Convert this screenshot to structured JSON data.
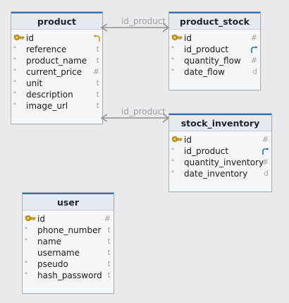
{
  "tables": {
    "product": {
      "name": "product",
      "fields": [
        {
          "name": "id",
          "type": "",
          "pk": true,
          "required": true,
          "ref": "in"
        },
        {
          "name": "reference",
          "type": "t",
          "required": true
        },
        {
          "name": "product_name",
          "type": "t",
          "required": true
        },
        {
          "name": "current_price",
          "type": "#",
          "required": true
        },
        {
          "name": "unit",
          "type": "t",
          "required": true
        },
        {
          "name": "description",
          "type": "t",
          "required": true
        },
        {
          "name": "image_url",
          "type": "t",
          "required": true
        }
      ]
    },
    "product_stock": {
      "name": "product_stock",
      "fields": [
        {
          "name": "id",
          "type": "#",
          "pk": true,
          "required": true
        },
        {
          "name": "id_product",
          "type": "",
          "required": true,
          "ref": "out"
        },
        {
          "name": "quantity_flow",
          "type": "#",
          "required": true
        },
        {
          "name": "date_flow",
          "type": "d",
          "required": true
        }
      ]
    },
    "stock_inventory": {
      "name": "stock_inventory",
      "fields": [
        {
          "name": "id",
          "type": "#",
          "pk": true,
          "required": false
        },
        {
          "name": "id_product",
          "type": "",
          "required": true,
          "ref": "out"
        },
        {
          "name": "quantity_inventory",
          "type": "#",
          "required": true
        },
        {
          "name": "date_inventory",
          "type": "d",
          "required": true
        }
      ]
    },
    "user": {
      "name": "user",
      "fields": [
        {
          "name": "id",
          "type": "#",
          "pk": true,
          "required": true
        },
        {
          "name": "phone_number",
          "type": "t",
          "required": true
        },
        {
          "name": "name",
          "type": "t",
          "required": true
        },
        {
          "name": "username",
          "type": "t",
          "required": false
        },
        {
          "name": "pseudo",
          "type": "t",
          "required": true
        },
        {
          "name": "hash_password",
          "type": "t",
          "required": true
        }
      ]
    }
  },
  "relations": [
    {
      "label": "id_product",
      "from": "product_stock",
      "to": "product"
    },
    {
      "label": "id_product",
      "from": "stock_inventory",
      "to": "product"
    }
  ],
  "colors": {
    "header_accent": "#2d6fb3",
    "link_line": "#8e8f90",
    "key_gold": "#d4a017",
    "fk_blue": "#2d6fb3"
  }
}
